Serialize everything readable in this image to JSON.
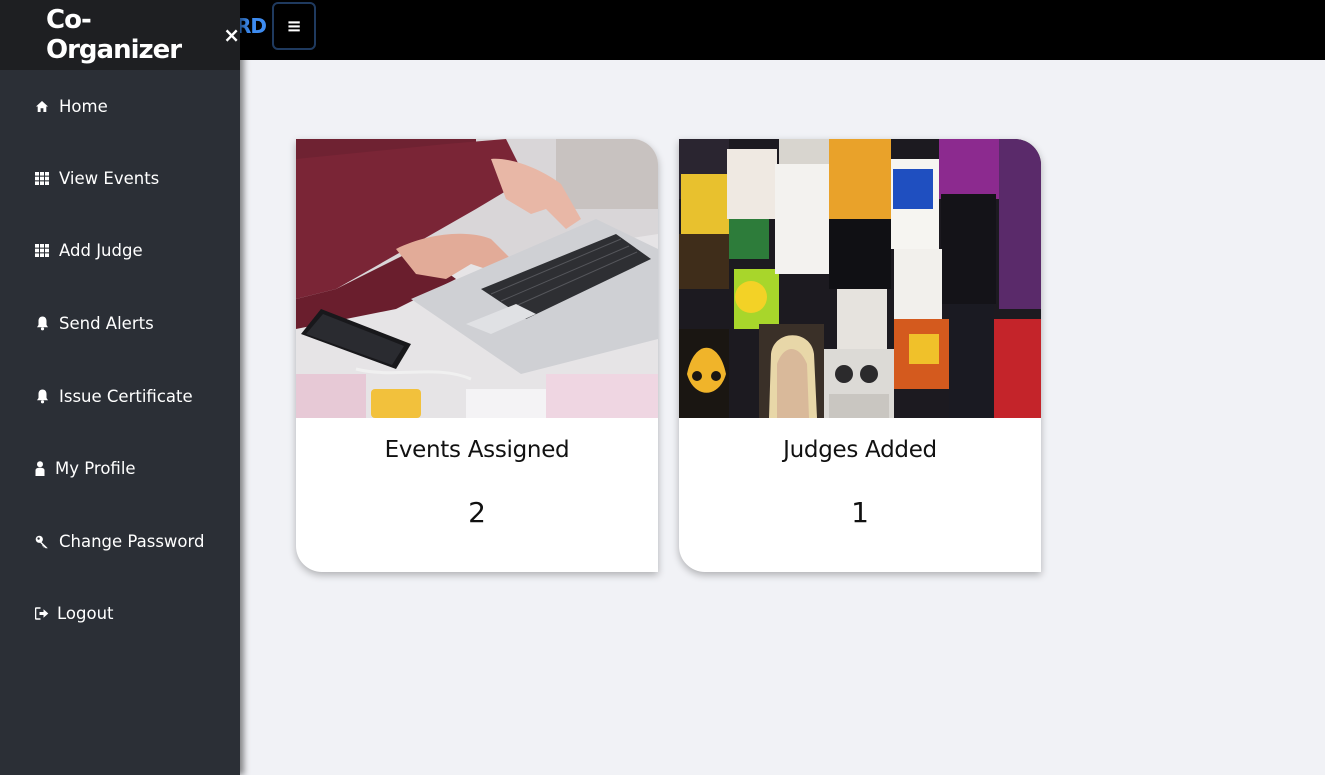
{
  "topbar": {
    "brand_peek": "RD",
    "menu_button_glyph": "≡"
  },
  "sidebar": {
    "title": "Co-Organizer",
    "close_glyph": "×",
    "items": [
      {
        "label": "Home",
        "icon": "home-icon"
      },
      {
        "label": "View Events",
        "icon": "grid-icon"
      },
      {
        "label": "Add Judge",
        "icon": "grid-icon"
      },
      {
        "label": "Send Alerts",
        "icon": "bell-icon"
      },
      {
        "label": "Issue Certificate",
        "icon": "bell-icon"
      },
      {
        "label": "My Profile",
        "icon": "user-icon"
      },
      {
        "label": "Change Password",
        "icon": "key-icon"
      },
      {
        "label": "Logout",
        "icon": "logout-icon"
      }
    ]
  },
  "cards": [
    {
      "title": "Events Assigned",
      "count": "2",
      "image": "laptop-photo"
    },
    {
      "title": "Judges Added",
      "count": "1",
      "image": "posters-wall-photo"
    }
  ],
  "colors": {
    "sidebar_bg": "#2b2f36",
    "sidebar_header_bg": "#1e1f22",
    "topbar_bg": "#000000",
    "page_bg": "#f1f2f6",
    "brand_accent": "#3d8bf0"
  }
}
